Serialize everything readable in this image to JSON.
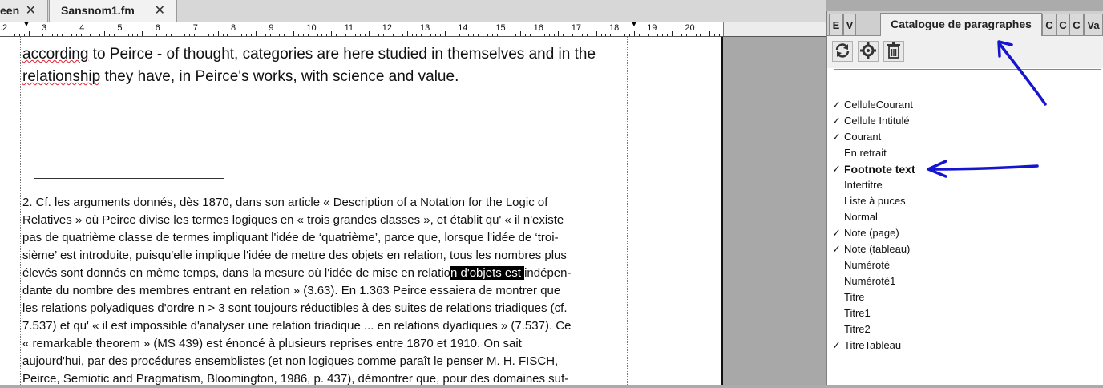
{
  "tabs": [
    {
      "label": "een",
      "close": "✕"
    },
    {
      "label": "Sansnom1.fm",
      "close": "✕"
    }
  ],
  "ruler": {
    "labels": [
      ".2",
      "3",
      "4",
      "5",
      "6",
      "7",
      "8",
      "9",
      "10",
      "11",
      "12",
      "13",
      "14",
      "15",
      "16",
      "17",
      "18",
      "19",
      "20"
    ]
  },
  "document": {
    "top_text_lines": [
      "according to Peirce - of thought, categories are here studied in themselves and in the",
      "relationship they have, in Peirce's works, with science and value."
    ],
    "footnote": {
      "line1": "2. Cf. les arguments donnés, dès 1870, dans son article « Description of a Notation for the Logic of",
      "line2": "Relatives » où Peirce divise les termes logiques en « trois grandes classes », et établit qu' « il n'existe",
      "line3": "pas de quatrième classe de termes impliquant l'idée de ‘quatrième’, parce que, lorsque l'idée de ‘troi-",
      "line4": "sième’ est introduite, puisqu'elle implique l'idée de mettre des objets en relation, tous les nombres plus",
      "line5_before": "élevés sont donnés en même temps, dans la mesure où l'idée de mise en relatio",
      "line5_selected": "n d'objets est ",
      "line5_after": "indépen-",
      "line6": "dante du nombre des membres entrant en relation » (3.63). En 1.363 Peirce essaiera de montrer que",
      "line7": "les relations polyadiques d'ordre n > 3 sont toujours réductibles à des suites de relations triadiques (cf.",
      "line8": "7.537) et qu' « il est impossible d'analyser une relation triadique ... en relations dyadiques » (7.537). Ce",
      "line9": "« remarkable theorem » (MS 439) est énoncé à plusieurs reprises entre 1870 et 1910. On sait",
      "line10": "aujourd'hui, par des procédures ensemblistes (et non logiques comme paraît le penser M. H. FISCH,",
      "line11": "Peirce, Semiotic and Pragmatism, Bloomington, 1986, p. 437), démontrer que, pour des domaines suf-"
    }
  },
  "panel": {
    "tabs": [
      "E",
      "V",
      "Catalogue de paragraphes",
      "C",
      "C",
      "C",
      "Va"
    ],
    "active_tab": "Catalogue de paragraphes",
    "search_value": "",
    "items": [
      {
        "label": "CelluleCourant",
        "checked": true
      },
      {
        "label": "Cellule Intitulé",
        "checked": true
      },
      {
        "label": "Courant",
        "checked": true
      },
      {
        "label": "En retrait",
        "checked": false
      },
      {
        "label": "Footnote text",
        "checked": true,
        "selected": true
      },
      {
        "label": "Intertitre",
        "checked": false
      },
      {
        "label": "Liste à puces",
        "checked": false
      },
      {
        "label": "Normal",
        "checked": false
      },
      {
        "label": "Note (page)",
        "checked": true
      },
      {
        "label": "Note (tableau)",
        "checked": true
      },
      {
        "label": "Numéroté",
        "checked": false
      },
      {
        "label": "Numéroté1",
        "checked": false
      },
      {
        "label": "Titre",
        "checked": false
      },
      {
        "label": "Titre1",
        "checked": false
      },
      {
        "label": "Titre2",
        "checked": false
      },
      {
        "label": "TitreTableau",
        "checked": true
      }
    ],
    "check_glyph": "✓"
  },
  "colors": {
    "annotation_arrow": "#1515d0",
    "squiggle": "#d02020"
  }
}
